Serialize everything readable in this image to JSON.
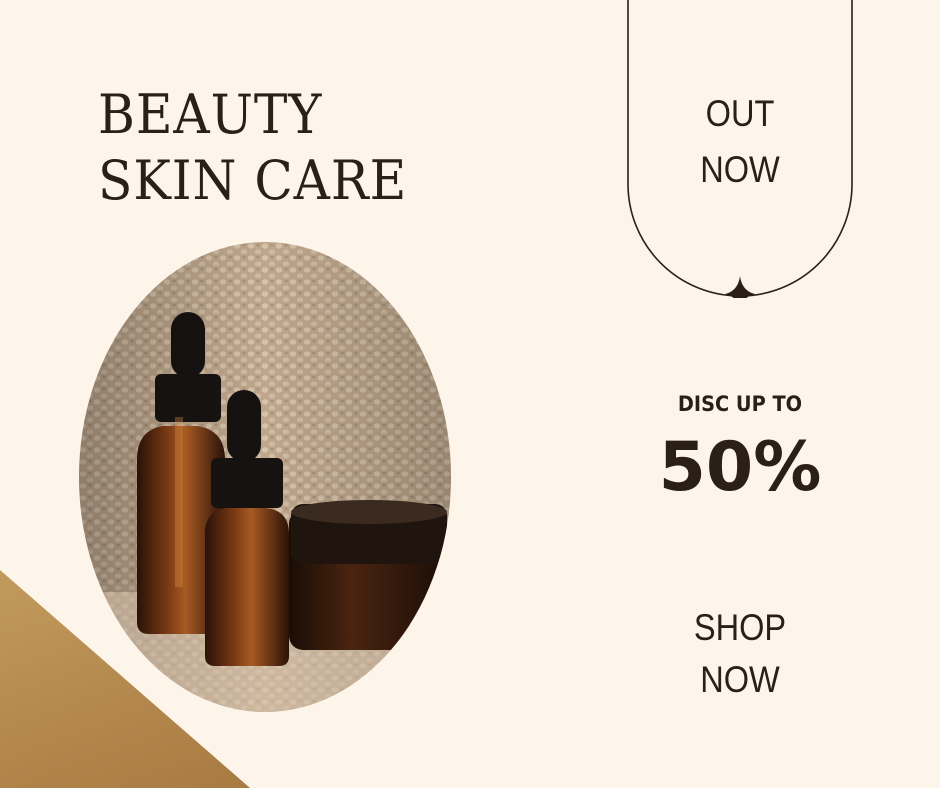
{
  "headline": {
    "line1": "BEAUTY",
    "line2": "SKIN CARE"
  },
  "badge": {
    "line1": "OUT",
    "line2": "NOW"
  },
  "offer": {
    "label": "DISC UP TO",
    "value": "50%"
  },
  "cta": {
    "line1": "SHOP",
    "line2": "NOW"
  },
  "colors": {
    "background": "#fdf5ea",
    "text": "#2b2018",
    "corner_accent": "#b3874c"
  },
  "icons": {
    "sparkle": "four-point-star"
  }
}
